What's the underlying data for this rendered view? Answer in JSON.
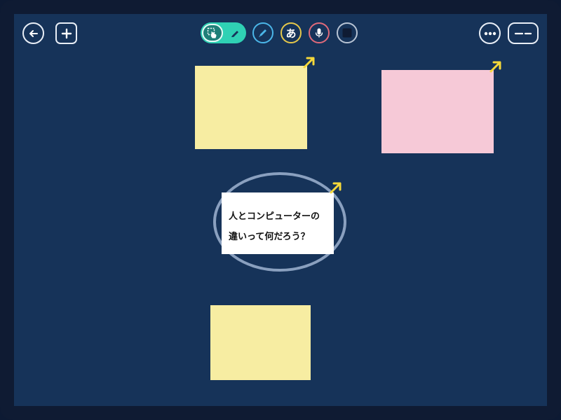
{
  "toolbar": {
    "left": {
      "back_icon": "arrow-left-icon",
      "add_icon": "plus-icon"
    },
    "center": {
      "mode_toggle": {
        "active": "hand-select",
        "options": [
          "hand-select-icon",
          "pen-icon"
        ],
        "color": "#2fd1b4"
      },
      "tools": [
        {
          "name": "pen-tool",
          "icon": "pencil-icon",
          "color": "#4bb6e8"
        },
        {
          "name": "text-tool",
          "label": "あ",
          "icon": "hiragana-a-icon",
          "color": "#e6c84a"
        },
        {
          "name": "voice-tool",
          "icon": "microphone-icon",
          "color": "#e06a7a"
        },
        {
          "name": "shape-tool",
          "icon": "square-icon",
          "color": "#b8c4d4"
        }
      ]
    },
    "right": {
      "more_icon": "more-dots-icon",
      "zoom_icon": "zoom-out-dashes-icon"
    }
  },
  "board": {
    "background": "#163359",
    "stickies": [
      {
        "name": "sticky-note-yellow-top",
        "color": "#f7eda2"
      },
      {
        "name": "sticky-note-pink",
        "color": "#f6c9d7"
      },
      {
        "name": "sticky-note-yellow-bottom",
        "color": "#f7eda2"
      }
    ],
    "expand_arrow_color": "#f5d83a",
    "center_card": {
      "line1": "人とコンピューターの",
      "line2": "違いって何だろう？",
      "ring_color": "#8aa0bf"
    }
  }
}
